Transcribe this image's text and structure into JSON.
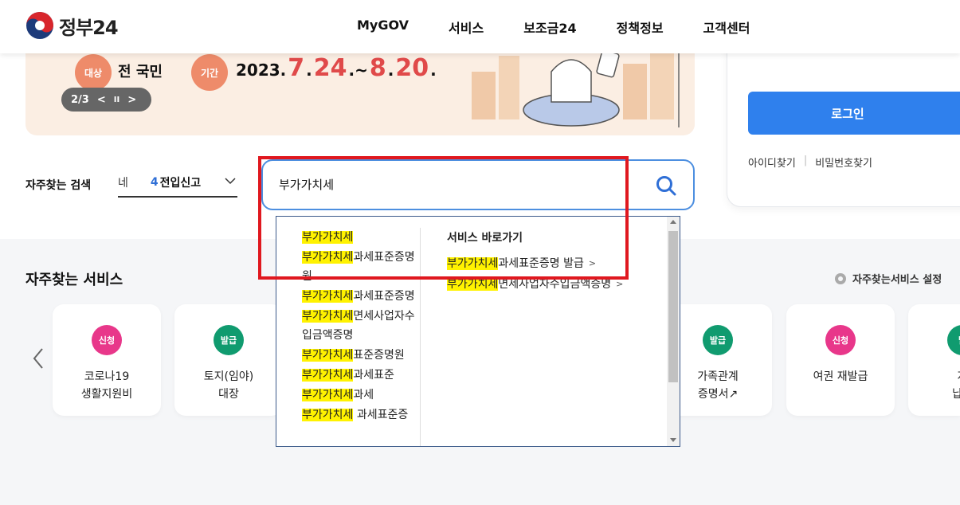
{
  "header": {
    "logo_text": "정부24",
    "nav": [
      "MyGOV",
      "서비스",
      "보조금24",
      "정책정보",
      "고객센터"
    ]
  },
  "banner": {
    "target_label": "대상",
    "target_value": "전 국민",
    "period_label": "기간",
    "date_prefix": "2023.",
    "date_m1": "7",
    "date_d1": "24",
    "date_sep": ".~",
    "date_m2": "8",
    "date_d2": "20",
    "date_end": ".",
    "carousel": {
      "page": "2/3",
      "prev": "<",
      "pause": "II",
      "next": ">"
    }
  },
  "search": {
    "faq_label": "자주찾는 검색",
    "keyword_fragment": "네",
    "keyword_rank": "4",
    "keyword_text": "전입신고",
    "query": "부가가치세"
  },
  "dropdown": {
    "highlight": "부가가치세",
    "suggestions": [
      {
        "hl": "부가가치세",
        "rest": ""
      },
      {
        "hl": "부가가치세",
        "rest": "과세표준증명원"
      },
      {
        "hl": "부가가치세",
        "rest": "과세표준증명"
      },
      {
        "hl": "부가가치세",
        "rest": "면세사업자수입금액증명"
      },
      {
        "hl": "부가가치세",
        "rest": "표준증명원"
      },
      {
        "hl": "부가가치세",
        "rest": "과세표준"
      },
      {
        "hl": "부가가치세",
        "rest": "과세"
      },
      {
        "hl": "부가가치세",
        "rest": " 과세표준증"
      }
    ],
    "shortcut_title": "서비스 바로가기",
    "shortcuts": [
      {
        "hl": "부가가치세",
        "rest": "과세표준증명 발급",
        "arrow": ">"
      },
      {
        "hl": "부가가치세",
        "rest": "면세사업자수입금액증명",
        "arrow": ">"
      }
    ]
  },
  "login": {
    "partial_text": "",
    "button": "로그인",
    "find_id": "아이디찾기",
    "find_pw": "비밀번호찾기"
  },
  "services": {
    "title": "자주찾는 서비스",
    "settings": "자주찾는서비스 설정",
    "cards": [
      {
        "badge": "신청",
        "type": "apply",
        "label": "코로나19\n생활지원비"
      },
      {
        "badge": "발급",
        "type": "issue",
        "label": "토지(임야)\n대장"
      },
      {
        "badge": "발급",
        "type": "issue",
        "label": "가족관계\n증명서↗"
      },
      {
        "badge": "신청",
        "type": "apply",
        "label": "여권 재발급"
      },
      {
        "badge": "발",
        "type": "issue",
        "label": "지\n납세"
      }
    ]
  },
  "colors": {
    "accent": "#2f80ed",
    "highlight": "#fff200",
    "annotation": "#e0181f",
    "apply_badge": "#e8378a",
    "issue_badge": "#109b6f"
  }
}
